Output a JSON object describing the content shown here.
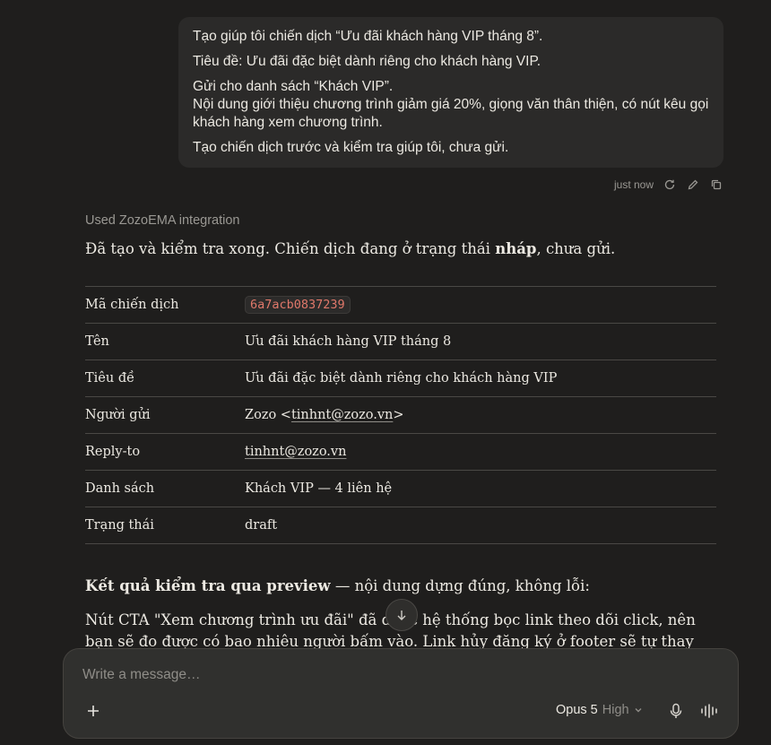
{
  "user_message": {
    "line1": "Tạo giúp tôi chiến dịch “Ưu đãi khách hàng VIP tháng 8”.",
    "line2": "Tiêu đề: Ưu đãi đặc biệt dành riêng cho khách hàng VIP.",
    "line3": "Gửi cho danh sách “Khách VIP”.",
    "line4": "Nội dung giới thiệu chương trình giảm giá 20%, giọng văn thân thiện, có nút kêu gọi khách hàng xem chương trình.",
    "line5": "Tạo chiến dịch trước và kiểm tra giúp tôi, chưa gửi.",
    "timestamp": "just now"
  },
  "assistant": {
    "used_integration": "Used ZozoEMA integration",
    "intro_before": "Đã tạo và kiểm tra xong. Chiến dịch đang ở trạng thái ",
    "intro_bold": "nháp",
    "intro_after": ", chưa gửi.",
    "table": {
      "id_label": "Mã chiến dịch",
      "id_value": "6a7acb0837239",
      "name_label": "Tên",
      "name_value": "Ưu đãi khách hàng VIP tháng 8",
      "subject_label": "Tiêu đề",
      "subject_value": "Ưu đãi đặc biệt dành riêng cho khách hàng VIP",
      "sender_label": "Người gửi",
      "sender_prefix": "Zozo <",
      "sender_email": "tinhnt@zozo.vn",
      "sender_suffix": ">",
      "replyto_label": "Reply-to",
      "replyto_value": "tinhnt@zozo.vn",
      "list_label": "Danh sách",
      "list_value": "Khách VIP — 4 liên hệ",
      "status_label": "Trạng thái",
      "status_value": "draft"
    },
    "result_bold": "Kết quả kiểm tra qua preview",
    "result_rest": " — nội dung dựng đúng, không lỗi:",
    "result_body": "Nút CTA \"Xem chương trình ưu đãi\" đã được hệ thống bọc link theo dõi click, nên bạn sẽ đo được có bao nhiêu người bấm vào. Link hủy đăng ký ở footer sẽ tự thay thành link thật khi gửi"
  },
  "composer": {
    "placeholder": "Write a message…",
    "model_name": "Opus 5",
    "effort": "High"
  },
  "icons": [
    "retry-icon",
    "edit-icon",
    "copy-icon",
    "arrow-down-icon",
    "plus-icon",
    "chevron-down-icon",
    "microphone-icon",
    "voice-waveform-icon"
  ]
}
